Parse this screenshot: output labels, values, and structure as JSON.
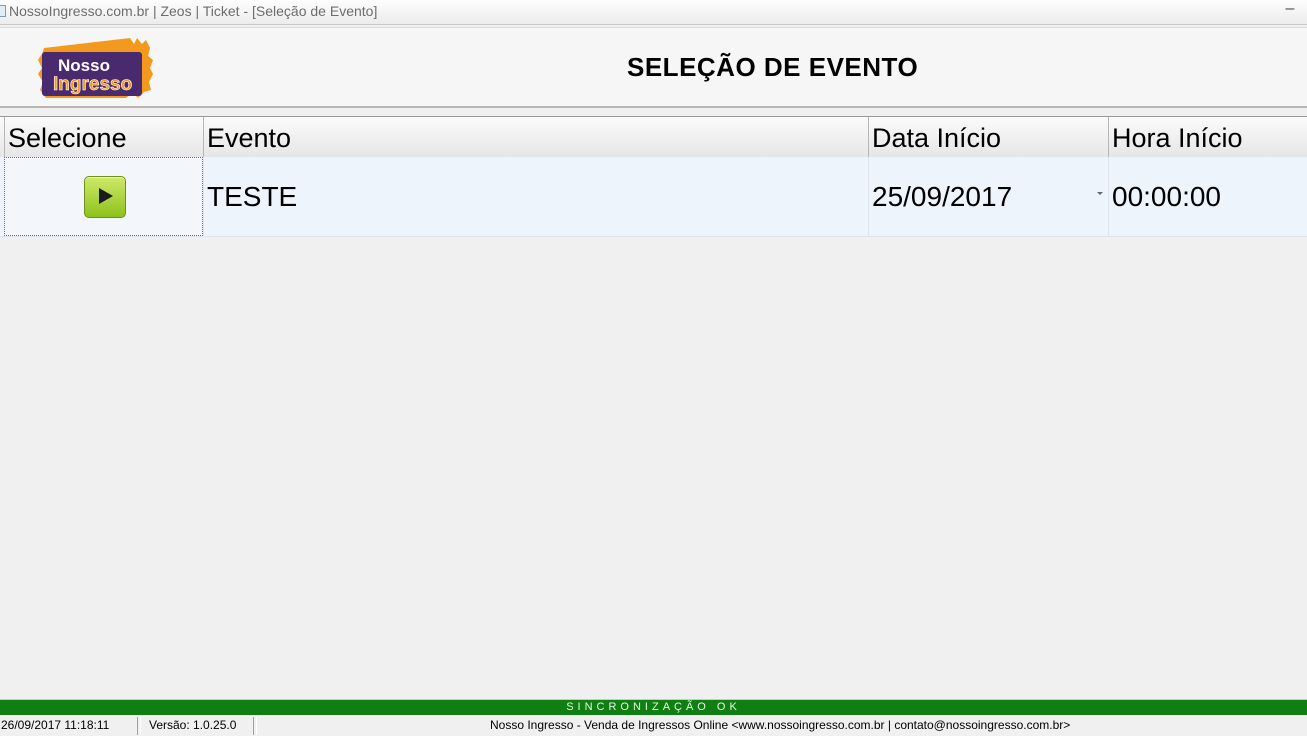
{
  "window": {
    "title": "NossoIngresso.com.br | Zeos | Ticket - [Seleção de Evento]",
    "minimize_label": "–"
  },
  "header": {
    "logo_text_line1": "Nosso",
    "logo_text_line2": "Ingresso",
    "page_title": "SELEÇÃO DE EVENTO"
  },
  "grid": {
    "columns": [
      "Selecione",
      "Evento",
      "Data Início",
      "Hora Início"
    ],
    "rows": [
      {
        "evento": "TESTE",
        "data_inicio": "25/09/2017",
        "hora_inicio": "00:00:00"
      }
    ]
  },
  "status": {
    "sync": "SINCRONIZAÇÃO OK",
    "datetime": "26/09/2017 11:18:11",
    "version": "Versão: 1.0.25.0",
    "footer": "Nosso Ingresso - Venda de Ingressos Online <www.nossoingresso.com.br | contato@nossoingresso.com.br>"
  },
  "colors": {
    "sync_bar": "#0f7f12",
    "logo_purple": "#4a2a6e",
    "logo_orange": "#f39a1e",
    "play_green": "#8cc21b"
  }
}
